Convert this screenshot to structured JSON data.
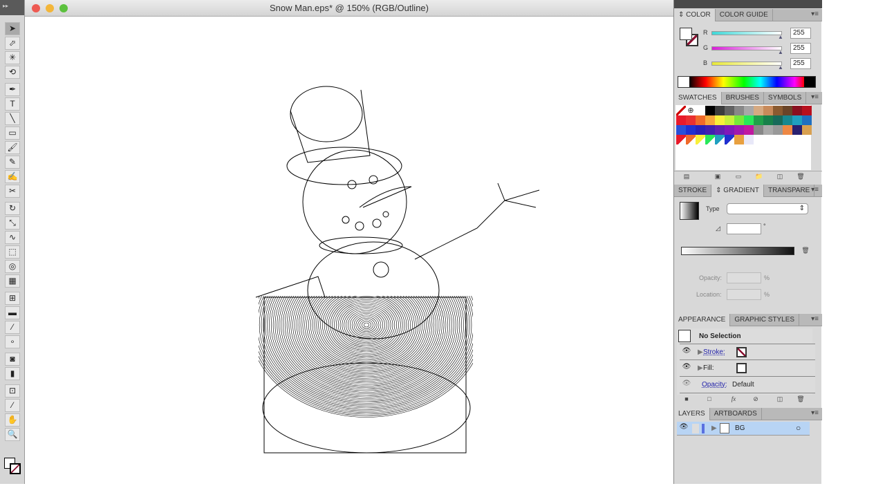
{
  "window": {
    "title": "Snow Man.eps* @ 150% (RGB/Outline)"
  },
  "toolbar": {
    "tools": [
      {
        "name": "selection-tool",
        "glyph": "➤"
      },
      {
        "name": "direct-selection-tool",
        "glyph": "⬀"
      },
      {
        "name": "magic-wand-tool",
        "glyph": "✳"
      },
      {
        "name": "lasso-tool",
        "glyph": "⟲"
      },
      {
        "name": "pen-tool",
        "glyph": "✒"
      },
      {
        "name": "type-tool",
        "glyph": "T"
      },
      {
        "name": "line-tool",
        "glyph": "╲"
      },
      {
        "name": "rectangle-tool",
        "glyph": "▭"
      },
      {
        "name": "paintbrush-tool",
        "glyph": "🖌"
      },
      {
        "name": "pencil-tool",
        "glyph": "✎"
      },
      {
        "name": "blob-brush-tool",
        "glyph": "✍"
      },
      {
        "name": "scissors-tool",
        "glyph": "✂"
      },
      {
        "name": "rotate-tool",
        "glyph": "↻"
      },
      {
        "name": "scale-tool",
        "glyph": "⤡"
      },
      {
        "name": "warp-tool",
        "glyph": "∿"
      },
      {
        "name": "free-transform-tool",
        "glyph": "⬚"
      },
      {
        "name": "shape-builder-tool",
        "glyph": "◎"
      },
      {
        "name": "perspective-grid-tool",
        "glyph": "▦"
      },
      {
        "name": "mesh-tool",
        "glyph": "⊞"
      },
      {
        "name": "gradient-tool",
        "glyph": "▬"
      },
      {
        "name": "eyedropper-tool",
        "glyph": "⁄"
      },
      {
        "name": "blend-tool",
        "glyph": "∘"
      },
      {
        "name": "symbol-sprayer-tool",
        "glyph": "◙"
      },
      {
        "name": "column-graph-tool",
        "glyph": "▮"
      },
      {
        "name": "artboard-tool",
        "glyph": "⊡"
      },
      {
        "name": "slice-tool",
        "glyph": "⁄"
      },
      {
        "name": "hand-tool",
        "glyph": "✋"
      },
      {
        "name": "zoom-tool",
        "glyph": "🔍"
      }
    ]
  },
  "color_panel": {
    "tabs": [
      "COLOR",
      "COLOR GUIDE"
    ],
    "channels": [
      {
        "label": "R",
        "value": "255",
        "color": "#3ed8d8"
      },
      {
        "label": "G",
        "value": "255",
        "color": "#d81ed8"
      },
      {
        "label": "B",
        "value": "255",
        "color": "#e8e83a"
      }
    ]
  },
  "swatches_panel": {
    "tabs": [
      "SWATCHES",
      "BRUSHES",
      "SYMBOLS"
    ],
    "colors": [
      "none",
      "reg",
      "#ffffff",
      "#000000",
      "#3c3c3c",
      "#626262",
      "#888888",
      "#a8a8a8",
      "#d6aa82",
      "#c88a5a",
      "#8a5a30",
      "#6a4428",
      "#8a1020",
      "#b8101e",
      "#e81a2a",
      "#ea3030",
      "#f06a2a",
      "#f8a83a",
      "#f8f03a",
      "#c8f03a",
      "#78e83a",
      "#28e85a",
      "#20a04a",
      "#18804a",
      "#186a5a",
      "#188890",
      "#20a0c0",
      "#2070c0",
      "#2850d8",
      "#2030d0",
      "#2820b8",
      "#4020b0",
      "#6020b0",
      "#8018b8",
      "#a018b0",
      "#c018a0",
      "#888888",
      "#aaaaaa",
      "#999999",
      "#ee8844",
      "#2a2070",
      "#d8a050",
      "#e81a2a",
      "#f06a2a",
      "#f8f03a",
      "#28e85a",
      "#20a0c0",
      "#2030d0",
      "#e8a040",
      "#e8e8f8"
    ]
  },
  "gradient_panel": {
    "tabs": [
      "STROKE",
      "GRADIENT",
      "TRANSPARE"
    ],
    "type_label": "Type",
    "opacity_label": "Opacity:",
    "location_label": "Location:",
    "percent": "%",
    "degree": "°"
  },
  "appearance_panel": {
    "tabs": [
      "APPEARANCE",
      "GRAPHIC STYLES"
    ],
    "title": "No Selection",
    "rows": [
      {
        "label": "Stroke:"
      },
      {
        "label": "Fill:"
      },
      {
        "label": "Opacity:",
        "value": "Default"
      }
    ]
  },
  "layers_panel": {
    "tabs": [
      "LAYERS",
      "ARTBOARDS"
    ],
    "layers": [
      {
        "name": "BG"
      }
    ]
  }
}
